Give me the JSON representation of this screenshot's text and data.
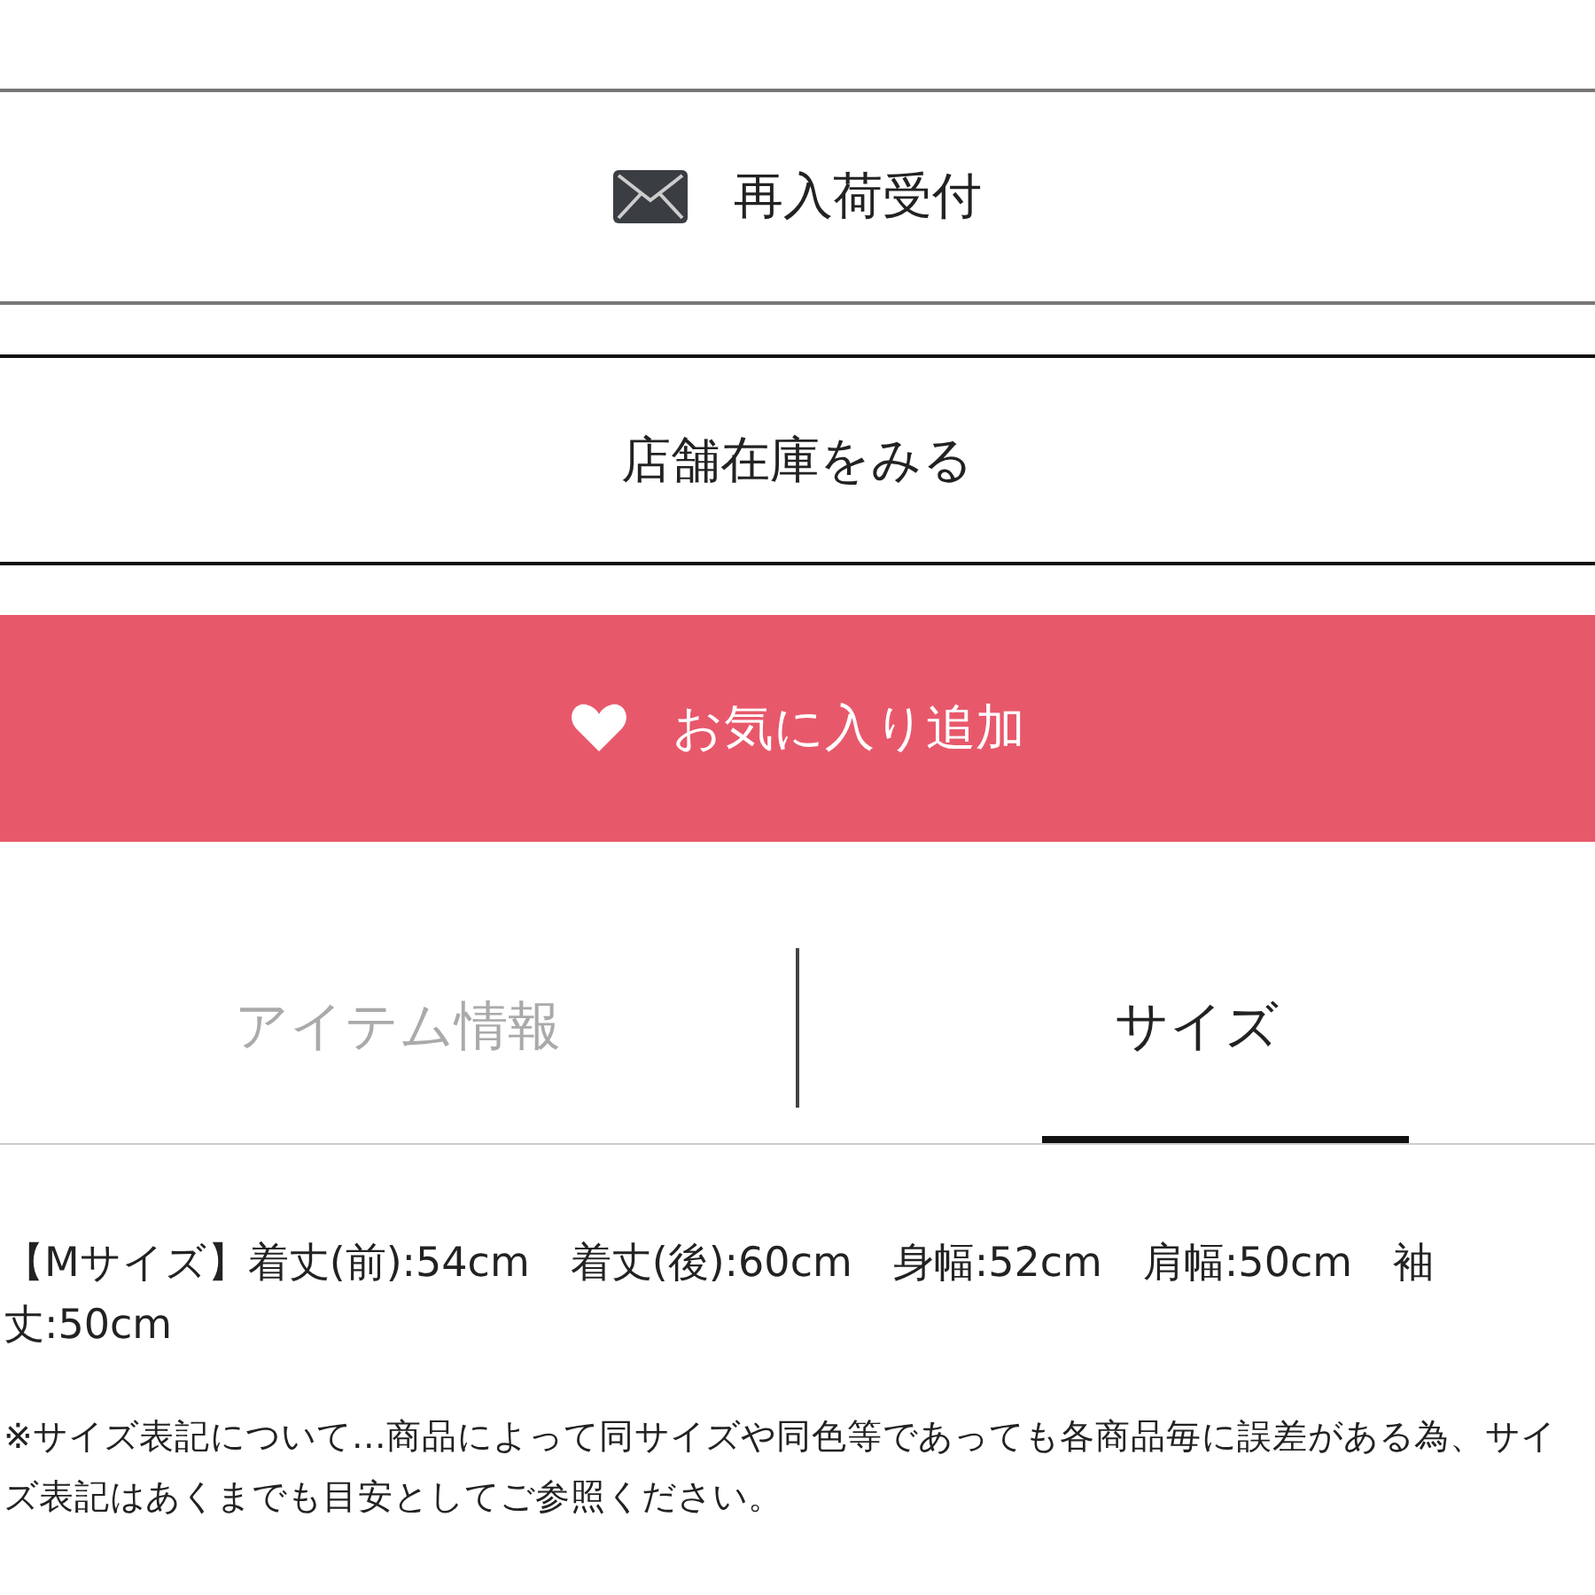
{
  "actions": [
    {
      "kind": "mail",
      "label": "再入荷受付"
    },
    {
      "kind": "plain",
      "label": "店舗在庫をみる"
    },
    {
      "kind": "favorite",
      "label": "お気に入り追加"
    }
  ],
  "tabs": [
    {
      "label": "アイテム情報",
      "selected": false
    },
    {
      "label": "サイズ",
      "selected": true
    }
  ],
  "size_text": "【Mサイズ】着丈(前):54cm　着丈(後):60cm　身幅:52cm　肩幅:50cm　袖丈:50cm",
  "note": "※サイズ表記について…商品によって同サイズや同色等であっても各商品毎に誤差がある為、サイズ表記はあくまでも目安としてご参照ください。"
}
